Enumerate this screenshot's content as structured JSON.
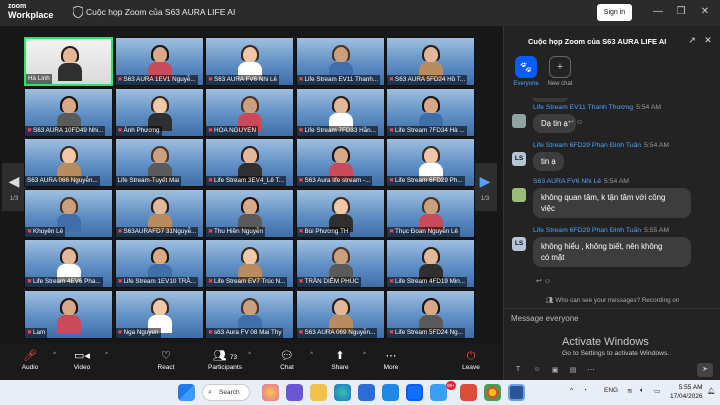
{
  "app": {
    "logo_line1": "zoom",
    "logo_line2": "Workplace",
    "window_title": "Cuộc họp Zoom của S63 AURA LIFE AI",
    "signin_label": "Sign in",
    "window_controls": [
      "minimize-icon",
      "restore-icon",
      "close-icon"
    ]
  },
  "gallery": {
    "page_left": "1/3",
    "page_right": "1/3",
    "tiles": [
      {
        "name": "Hà Linh",
        "muted": false
      },
      {
        "name": "S63 AURA 1EV1 Nguyễ...",
        "muted": true
      },
      {
        "name": "S63 AURA FV6 Nhi Lê",
        "muted": true
      },
      {
        "name": "Life Stream EV11 Thanh...",
        "muted": true
      },
      {
        "name": "S63 AURA 5FD24 Hồ T...",
        "muted": true
      },
      {
        "name": "S63 AURA 10FD49 Nhi...",
        "muted": true
      },
      {
        "name": "Ánh Phương",
        "muted": true
      },
      {
        "name": "HOA NGUYEN",
        "muted": true
      },
      {
        "name": "Life Stream 7FD33 Hằn...",
        "muted": true
      },
      {
        "name": "Life Stream 7FD34 Hà ...",
        "muted": true
      },
      {
        "name": "S63 AURA 066 Nguyễn...",
        "muted": false
      },
      {
        "name": "Life Stream-Tuyết Mai",
        "muted": false
      },
      {
        "name": "Life Stream 3EV4_Lê T...",
        "muted": true
      },
      {
        "name": "S63 Aura life stream -...",
        "muted": true
      },
      {
        "name": "Life Stream 6FD29 Ph...",
        "muted": true
      },
      {
        "name": "Khuyên Lê",
        "muted": true
      },
      {
        "name": "S63AURAFD7 31Nguyễ...",
        "muted": true
      },
      {
        "name": "Thu Hiền Nguyễn",
        "muted": true
      },
      {
        "name": "Bùi Phương TH",
        "muted": true
      },
      {
        "name": "Thục Đoan Nguyễn Lê",
        "muted": true
      },
      {
        "name": "Life Stream 4EV6 Pha...",
        "muted": true
      },
      {
        "name": "Life Stream 1EV10 TRẦ...",
        "muted": true
      },
      {
        "name": "Life Stream EV7 Trúc N...",
        "muted": true
      },
      {
        "name": "TRẦN DIỄM PHÚC",
        "muted": true
      },
      {
        "name": "Life Stream 4FD19 Min...",
        "muted": true
      },
      {
        "name": "Lam",
        "muted": true
      },
      {
        "name": "Nga Nguyen",
        "muted": true
      },
      {
        "name": "s63 Aura FV 08 Mai Thy",
        "muted": true
      },
      {
        "name": "S63 AURA 069 Nguyễn...",
        "muted": true
      },
      {
        "name": "Life Stream 5FD24 Ng...",
        "muted": true
      }
    ]
  },
  "toolbar": {
    "audio": "Audio",
    "video": "Video",
    "react": "React",
    "participants": "Participants",
    "participants_count": "73",
    "chat": "Chat",
    "share": "Share",
    "more": "More",
    "leave": "Leave"
  },
  "chat_panel": {
    "title": "Cuộc họp Zoom của S63 AURA LIFE AI",
    "tab_everyone": "Everyone",
    "tab_new_chat": "New chat",
    "messages": [
      {
        "avatar": "",
        "sender": "Life Stream EV11 Thanh Thương",
        "time": "5:54 AM",
        "text": "Dạ tin ạ"
      },
      {
        "avatar": "LS",
        "sender": "Life Stream 6FD29 Phan Đình Tuấn",
        "time": "5:54 AM",
        "text": "tin ạ"
      },
      {
        "avatar": "",
        "sender": "S63 AURA FV6 Nhi Lê",
        "time": "5:54 AM",
        "text_lines": [
          "không quan tâm, k tận tâm với công",
          "việc"
        ]
      },
      {
        "avatar": "LS",
        "sender": "Life Stream 6FD29 Phan Đình Tuấn",
        "time": "5:55 AM",
        "text_lines": [
          "không hiểu , không biết, nên không",
          "có mặt"
        ]
      }
    ],
    "recording_notice": "Who can see your messages? Recording on",
    "compose_placeholder": "Message everyone",
    "activate_title": "Activate Windows",
    "activate_sub": "Go to Settings to activate Windows."
  },
  "taskbar": {
    "search_label": "Search",
    "badge_count": "99+",
    "language": "ENG",
    "time": "5:55 AM",
    "date": "17/04/2026"
  }
}
